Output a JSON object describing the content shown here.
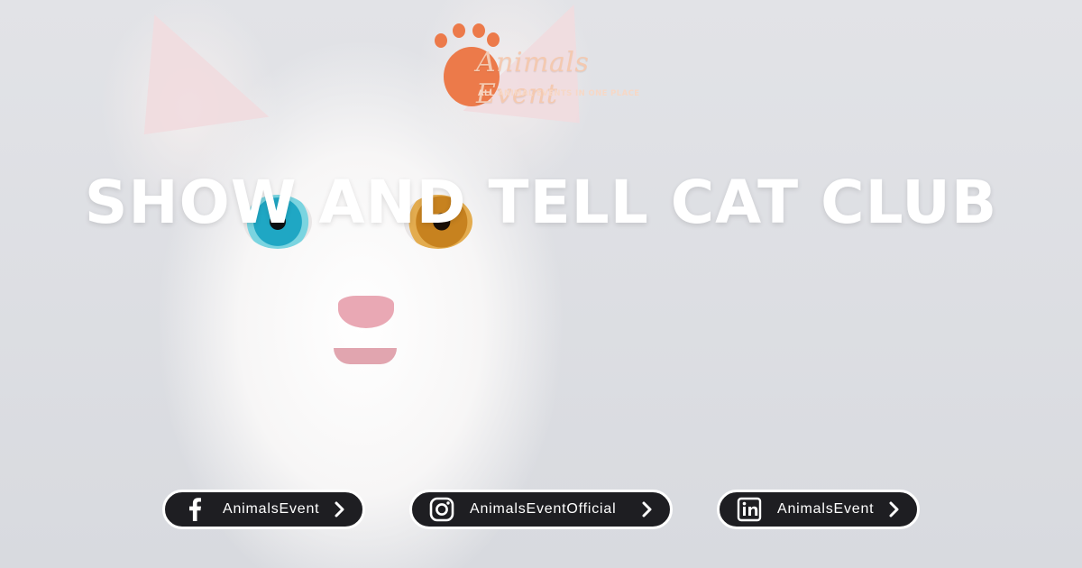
{
  "logo": {
    "name": "Animals Event",
    "tagline": "ALL ANIMAL EVENTS IN ONE PLACE",
    "accent_color": "#ec7a4a"
  },
  "headline": "SHOW AND TELL CAT CLUB",
  "social": [
    {
      "icon": "facebook-icon",
      "label": "AnimalsEvent"
    },
    {
      "icon": "instagram-icon",
      "label": "AnimalsEventOfficial"
    },
    {
      "icon": "linkedin-icon",
      "label": "AnimalsEvent"
    }
  ]
}
